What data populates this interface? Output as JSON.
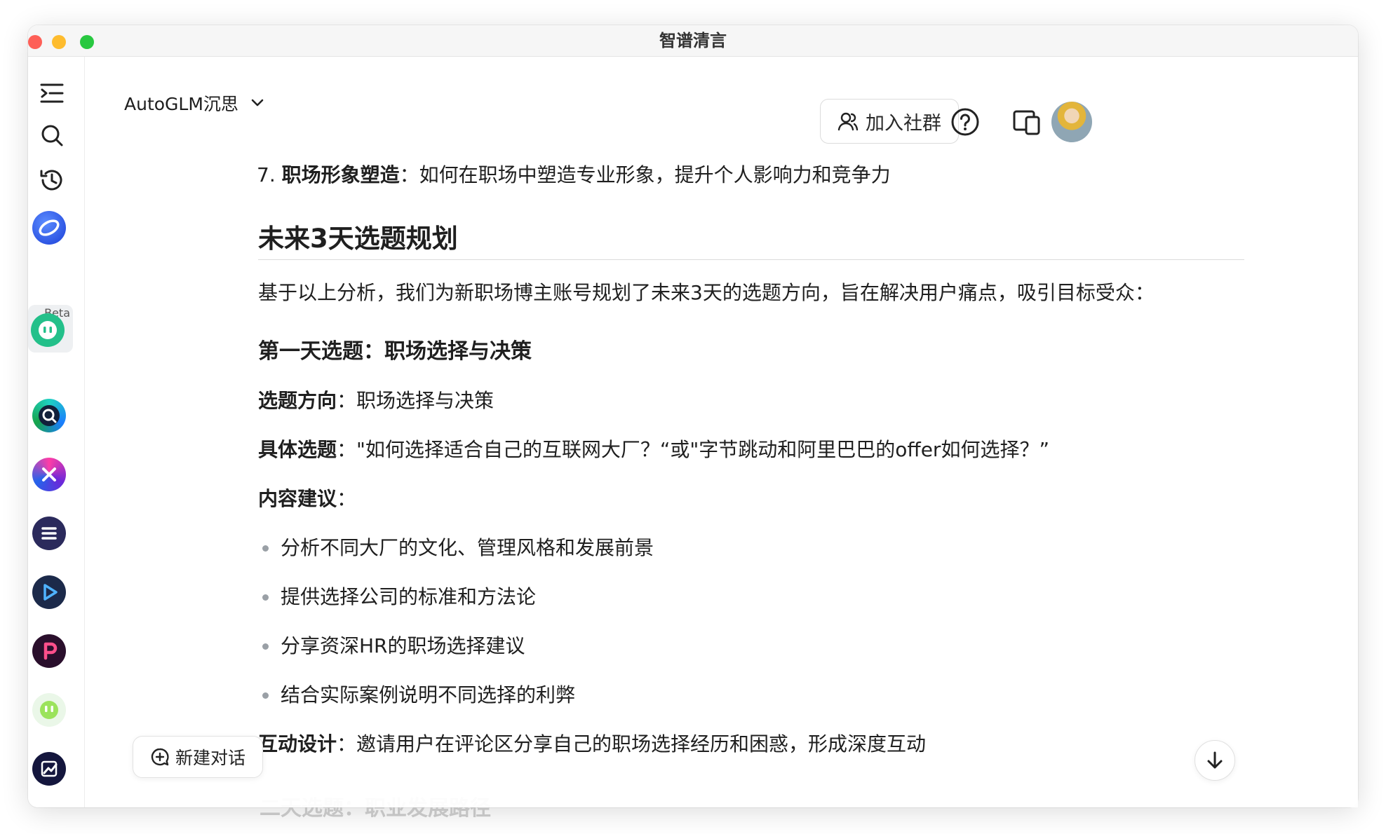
{
  "window": {
    "title": "智谱清言"
  },
  "header": {
    "model_name": "AutoGLM沉思",
    "join_label": "加入社群"
  },
  "sidebar": {
    "beta_label": "Beta"
  },
  "content": {
    "item7_num": "7. ",
    "item7_title": "职场形象塑造",
    "item7_text": "：如何在职场中塑造专业形象，提升个人影响力和竞争力",
    "section_title": "未来3天选题规划",
    "intro": "基于以上分析，我们为新职场博主账号规划了未来3天的选题方向，旨在解决用户痛点，吸引目标受众：",
    "day1_title": "第一天选题：职场选择与决策",
    "direction_label": "选题方向",
    "direction_text": "：职场选择与决策",
    "topic_label": "具体选题",
    "topic_text": "：\"如何选择适合自己的互联网大厂？“或\"字节跳动和阿里巴巴的offer如何选择？”",
    "advice_label": "内容建议",
    "advice_colon": "：",
    "bullets": [
      "分析不同大厂的文化、管理风格和发展前景",
      "提供选择公司的标准和方法论",
      "分享资深HR的职场选择建议",
      "结合实际案例说明不同选择的利弊"
    ],
    "interact_label": "互动设计",
    "interact_text": "：邀请用户在评论区分享自己的职场选择经历和困惑，形成深度互动",
    "next_peek": "二天选题：职业发展路径"
  },
  "footer": {
    "new_chat_label": "新建对话"
  },
  "colors": {
    "accent": "#2563eb",
    "text": "#1f1f1f",
    "muted": "#9aa0a6"
  }
}
